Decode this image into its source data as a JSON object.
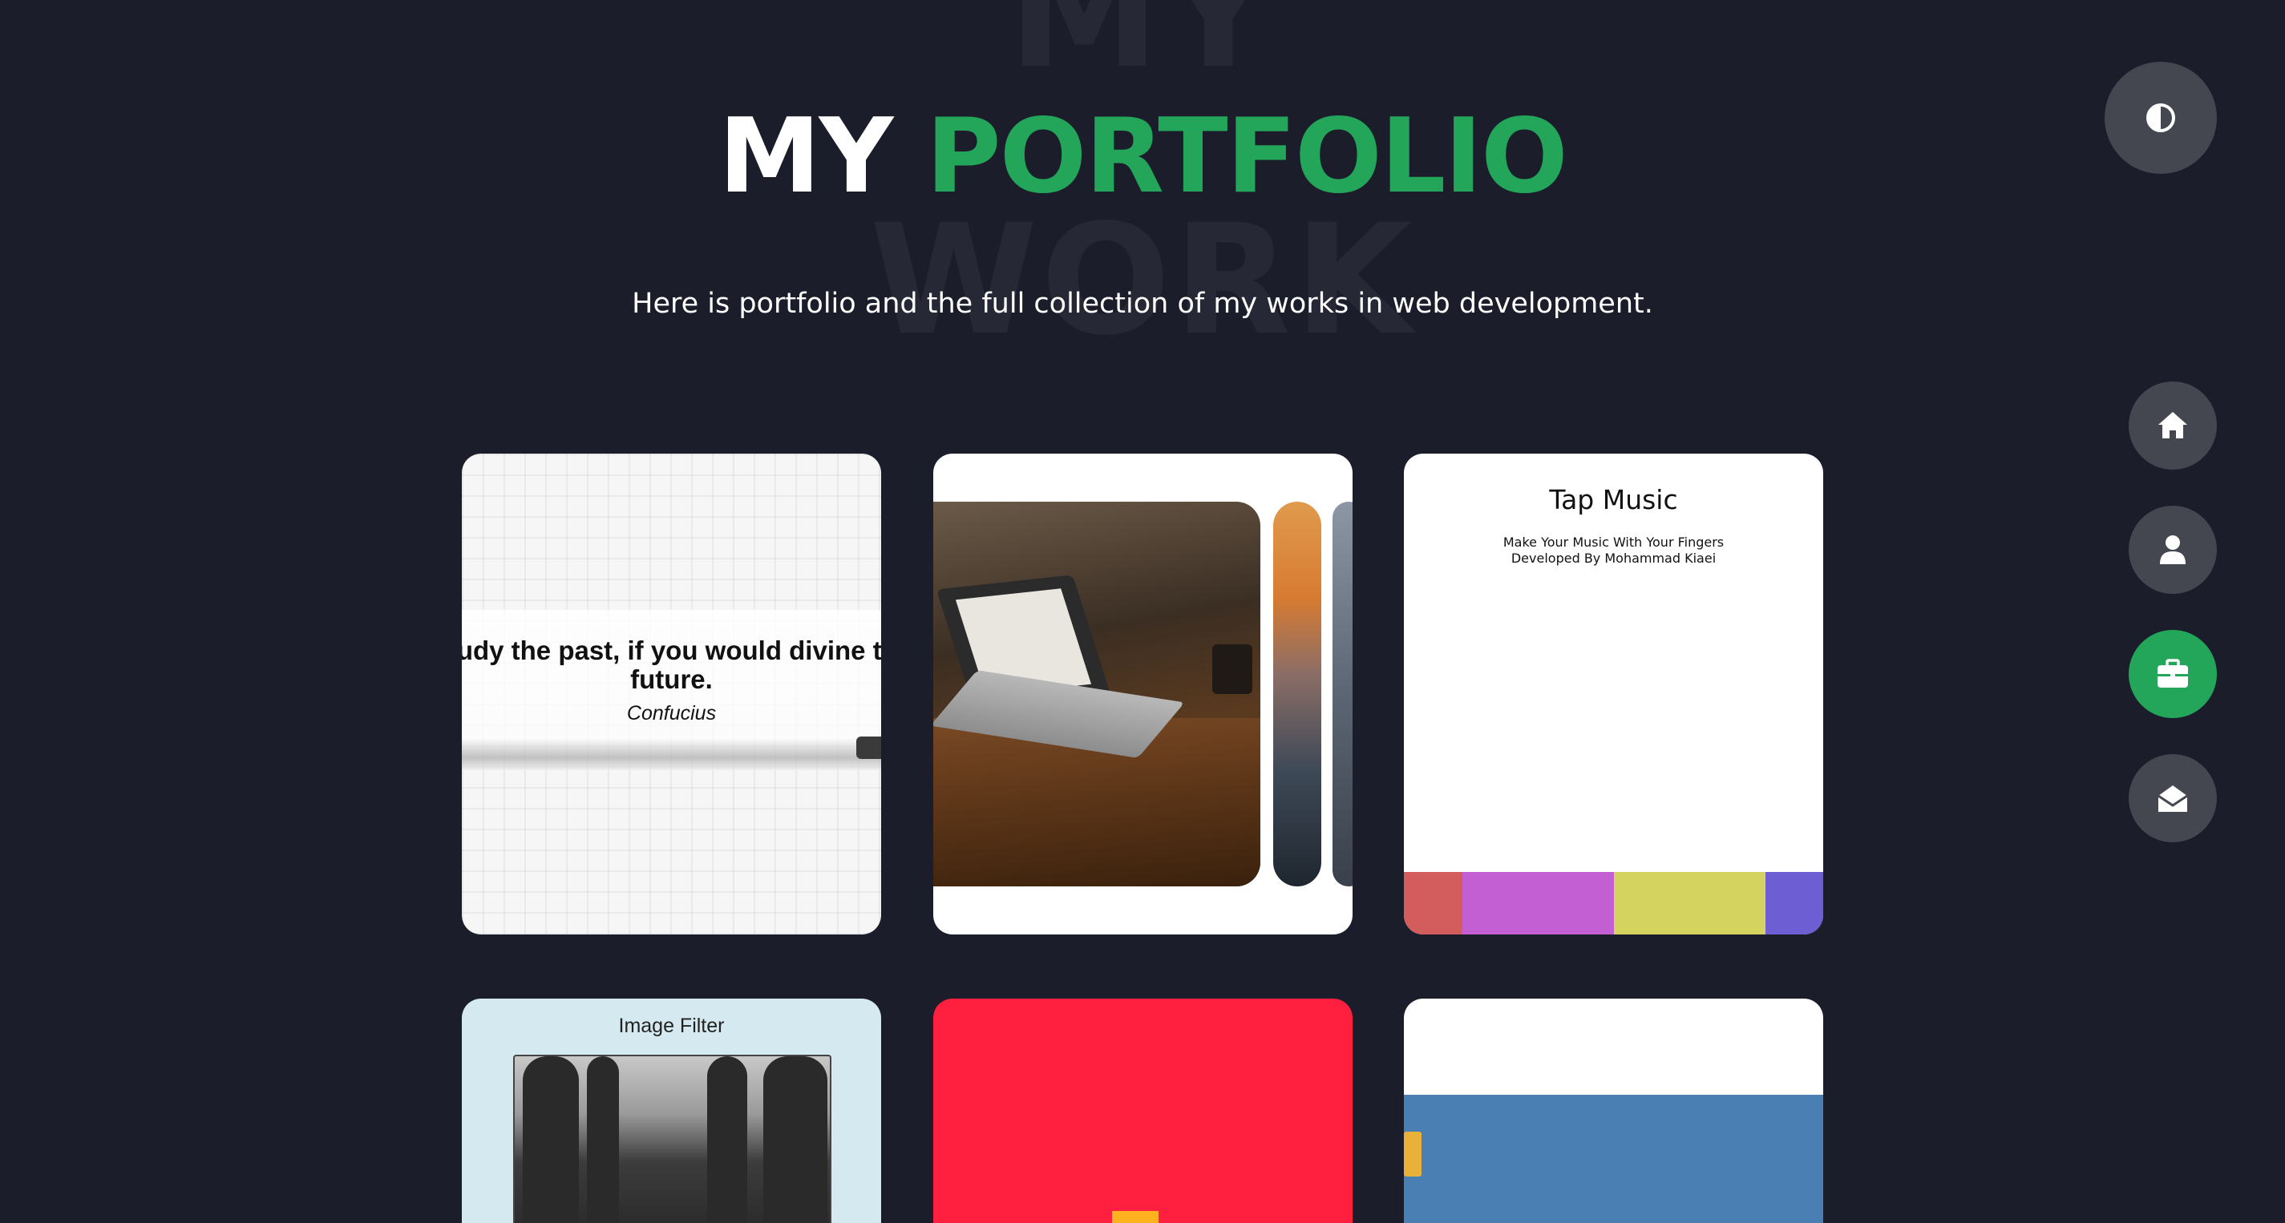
{
  "header": {
    "bg_word_top": "MY",
    "bg_word_bottom": "WORK",
    "title_white": "MY",
    "title_green": "PORTFOLIO",
    "subtitle": "Here is portfolio and the full collection of my works in web development."
  },
  "colors": {
    "background": "#1b1d2b",
    "accent": "#23a65a",
    "button": "#44474f"
  },
  "controls": {
    "theme_toggle_icon": "half-circle-icon",
    "nav": [
      {
        "name": "home",
        "icon": "home-icon",
        "active": false
      },
      {
        "name": "about",
        "icon": "user-icon",
        "active": false
      },
      {
        "name": "portfolio",
        "icon": "briefcase-icon",
        "active": true
      },
      {
        "name": "contact",
        "icon": "envelope-open-icon",
        "active": false
      }
    ]
  },
  "projects": {
    "quote": {
      "text_line1": "Study the past, if you would divine the",
      "text_line2": "future.",
      "author": "Confucius"
    },
    "slider": {
      "description": "image slider preview"
    },
    "tap_music": {
      "title": "Tap Music",
      "line1": "Make Your Music With Your Fingers",
      "line2": "Developed By Mohammad Kiaei",
      "pad_colors": [
        "#d35c5c",
        "#c35fd3",
        "#d5d35f",
        "#6d5fd3"
      ]
    },
    "image_filter": {
      "title": "Image Filter"
    },
    "red_project": {
      "color": "#ff203f"
    },
    "blue_project": {
      "color": "#4a7fb4"
    }
  }
}
